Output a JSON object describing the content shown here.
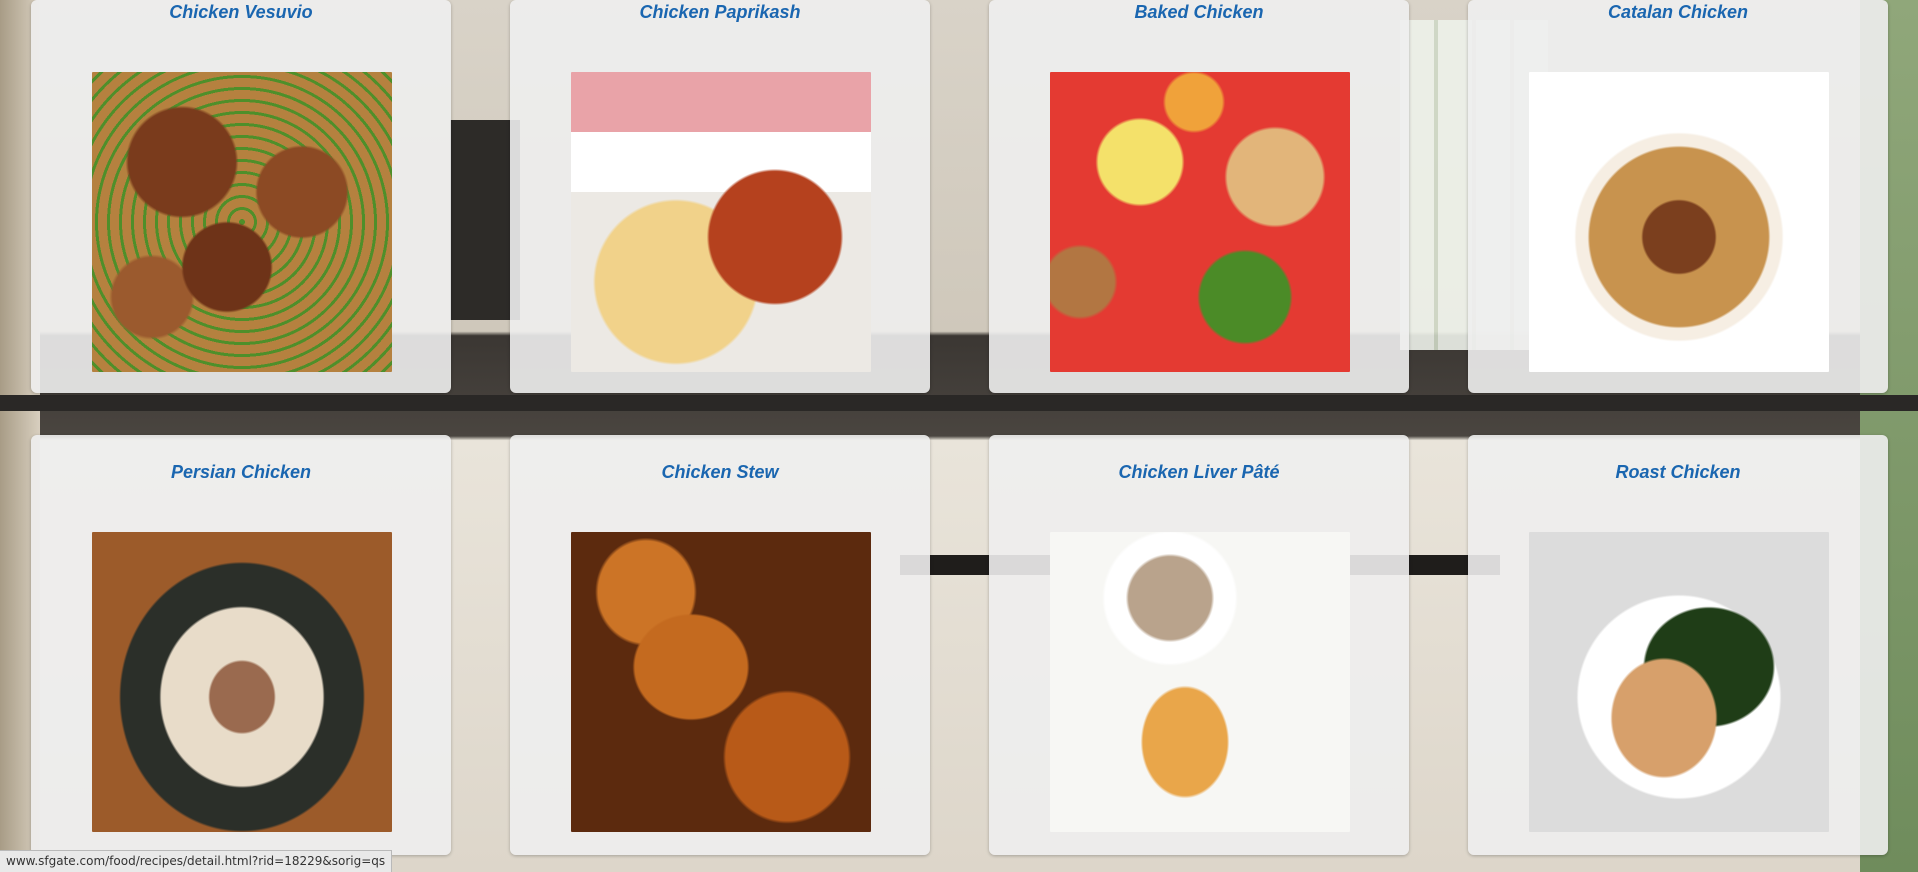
{
  "recipes": [
    {
      "title": "Chicken Vesuvio",
      "image": "chicken-vesuvio-photo"
    },
    {
      "title": "Chicken Paprikash",
      "image": "chicken-paprikash-photo"
    },
    {
      "title": "Baked Chicken",
      "image": "baked-chicken-photo"
    },
    {
      "title": "Catalan Chicken",
      "image": "catalan-chicken-photo"
    },
    {
      "title": "Persian Chicken",
      "image": "persian-chicken-photo"
    },
    {
      "title": "Chicken Stew",
      "image": "chicken-stew-photo"
    },
    {
      "title": "Chicken Liver Pâté",
      "image": "chicken-liver-pate-photo"
    },
    {
      "title": "Roast Chicken",
      "image": "roast-chicken-photo"
    }
  ],
  "status_bar": {
    "url": "www.sfgate.com/food/recipes/detail.html?rid=18229&sorig=qs"
  }
}
